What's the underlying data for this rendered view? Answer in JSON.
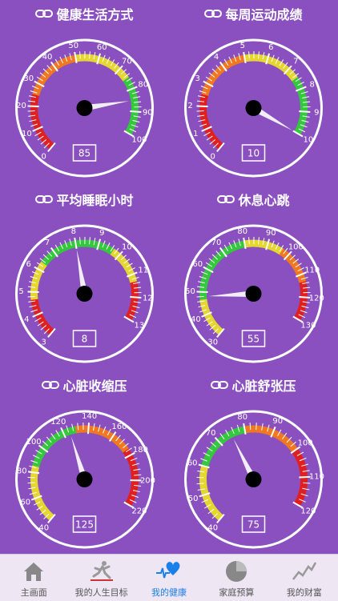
{
  "accent": "#1a7fe8",
  "gauges": [
    {
      "title": "健康生活方式",
      "min": 0,
      "max": 100,
      "step": 10,
      "value": 85,
      "value_label": "85",
      "ticks": [
        "0",
        "10",
        "20",
        "30",
        "40",
        "50",
        "60",
        "70",
        "80",
        "90",
        "100"
      ],
      "zones": [
        "#e02020",
        "#f07820",
        "#e6d630",
        "#34c83c"
      ]
    },
    {
      "title": "每周运动成绩",
      "min": 0,
      "max": 10,
      "step": 1,
      "value": 10,
      "value_label": "10",
      "ticks": [
        "0",
        "1",
        "2",
        "3",
        "4",
        "5",
        "6",
        "7",
        "8",
        "9",
        "10"
      ],
      "zones": [
        "#e02020",
        "#f07820",
        "#e6d630",
        "#34c83c"
      ]
    },
    {
      "title": "平均睡眠小时",
      "min": 3,
      "max": 13,
      "step": 1,
      "value": 8,
      "value_label": "8",
      "ticks": [
        "3",
        "4",
        "5",
        "6",
        "7",
        "8",
        "9",
        "10",
        "11",
        "12",
        "13"
      ],
      "zones": [
        "#e02020",
        "#e6d630",
        "#34c83c",
        "#34c83c",
        "#e6d630",
        "#e02020"
      ]
    },
    {
      "title": "休息心跳",
      "min": 30,
      "max": 130,
      "step": 10,
      "value": 48,
      "value_label": "55",
      "ticks": [
        "30",
        "40",
        "50",
        "60",
        "70",
        "80",
        "90",
        "100",
        "110",
        "120",
        "130"
      ],
      "zones": [
        "#e6d630",
        "#34c83c",
        "#34c83c",
        "#e6d630",
        "#f07820",
        "#e02020"
      ]
    },
    {
      "title": "心脏收缩压",
      "min": 40,
      "max": 220,
      "step": 20,
      "value": 125,
      "value_label": "125",
      "ticks": [
        "40",
        "60",
        "80",
        "100",
        "120",
        "140",
        "160",
        "180",
        "200",
        "220"
      ],
      "zones": [
        "#e6d630",
        "#34c83c",
        "#f07820",
        "#e02020"
      ]
    },
    {
      "title": "心脏舒张压",
      "min": 40,
      "max": 120,
      "step": 10,
      "value": 75,
      "value_label": "75",
      "ticks": [
        "40",
        "50",
        "60",
        "70",
        "80",
        "90",
        "100",
        "110",
        "120"
      ],
      "zones": [
        "#e6d630",
        "#34c83c",
        "#f07820",
        "#e02020"
      ]
    }
  ],
  "tabs": [
    {
      "label": "主画面",
      "icon": "home-icon"
    },
    {
      "label": "我的人生目标",
      "icon": "goal-runner-icon"
    },
    {
      "label": "我的健康",
      "icon": "heart-pulse-icon",
      "active": true
    },
    {
      "label": "家庭预算",
      "icon": "pie-chart-icon"
    },
    {
      "label": "我的财富",
      "icon": "trend-line-icon"
    }
  ]
}
